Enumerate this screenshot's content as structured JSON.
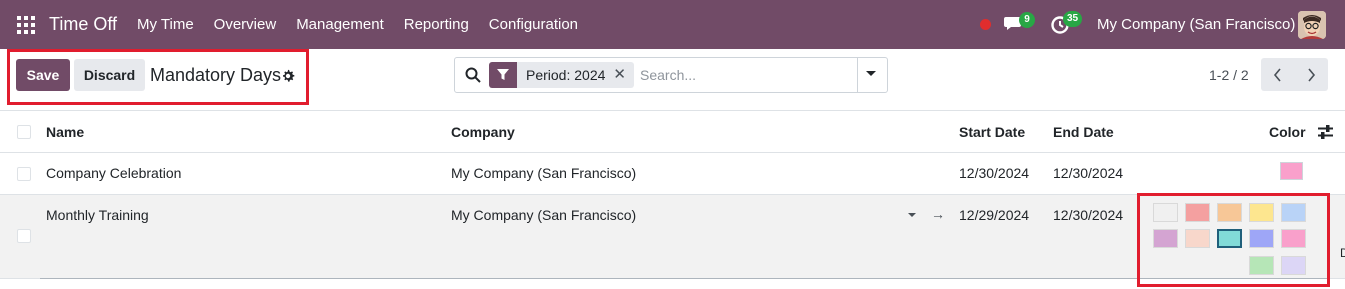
{
  "navbar": {
    "app_name": "Time Off",
    "menu": [
      "My Time",
      "Overview",
      "Management",
      "Reporting",
      "Configuration"
    ],
    "chat_count": "9",
    "activity_count": "35",
    "company": "My Company (San Francisco)",
    "colors": {
      "bar": "#714b67",
      "badge": "#28a745",
      "status_dot": "#e02d2d"
    }
  },
  "control": {
    "save_label": "Save",
    "discard_label": "Discard",
    "title": "Mandatory Days",
    "facet_label": "Period: 2024",
    "search_placeholder": "Search...",
    "pager": "1-2 / 2"
  },
  "table": {
    "columns": {
      "name": "Name",
      "company": "Company",
      "start": "Start Date",
      "end": "End Date",
      "color": "Color"
    },
    "rows": [
      {
        "name": "Company Celebration",
        "company": "My Company (San Francisco)",
        "start": "12/30/2024",
        "end": "12/30/2024",
        "color": "#f9a0cb"
      },
      {
        "name": "Monthly Training",
        "company": "My Company (San Francisco)",
        "start": "12/29/2024",
        "end": "12/30/2024",
        "color": "#81dbd8"
      }
    ]
  },
  "color_picker": {
    "swatches": [
      "#f0f0f0",
      "#f4a0a0",
      "#f7c797",
      "#fde68f",
      "#b9d3f7",
      "#d4a4d2",
      "#f8d7cb",
      "#81dbd8",
      "#9ea6f7",
      "#f9a0cb",
      "#b6e6b7",
      "#dcd6f6"
    ],
    "selected_index": 7
  }
}
